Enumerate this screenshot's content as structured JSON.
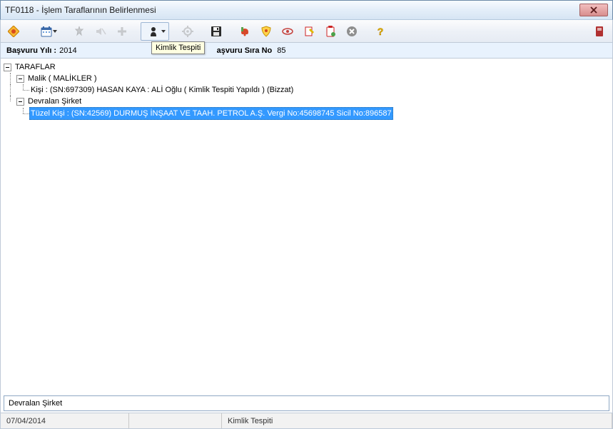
{
  "window": {
    "title": "TF0118 - İşlem Taraflarının Belirlenmesi"
  },
  "tooltip": {
    "text": "Kimlik Tespiti"
  },
  "info": {
    "year_label": "Başvuru Yılı  :",
    "year_value": "2014",
    "seq_label": "aşvuru Sıra No",
    "seq_value": "85"
  },
  "tree": {
    "root": {
      "label": "TARAFLAR",
      "nodes": [
        {
          "label": "Malik ( MALİKLER )",
          "children": [
            {
              "label": "Kişi : (SN:697309) HASAN KAYA : ALİ Oğlu ( Kimlik Tespiti Yapıldı ) (Bizzat)"
            }
          ]
        },
        {
          "label": "Devralan Şirket",
          "children": [
            {
              "label": "Tüzel Kişi : (SN:42569) DURMUŞ İNŞAAT VE TAAH. PETROL A.Ş.  Vergi No:45698745 Sicil No:896587",
              "selected": true
            }
          ]
        }
      ]
    }
  },
  "selected_path": "Devralan Şirket",
  "status": {
    "date": "07/04/2014",
    "message": "Kimlik Tespiti"
  },
  "icons": {
    "logo": "logo-icon",
    "calendar": "calendar-icon",
    "spark": "wizard-icon",
    "speaker_del": "speaker-remove-icon",
    "plus": "plus-icon",
    "person": "person-icon",
    "gear": "gear-icon",
    "save": "save-icon",
    "bell": "bell-icon",
    "shield": "shield-icon",
    "eye": "eye-icon",
    "edit": "edit-icon",
    "clipboard": "clipboard-icon",
    "stop": "stop-icon",
    "help": "help-icon",
    "record": "record-icon"
  }
}
